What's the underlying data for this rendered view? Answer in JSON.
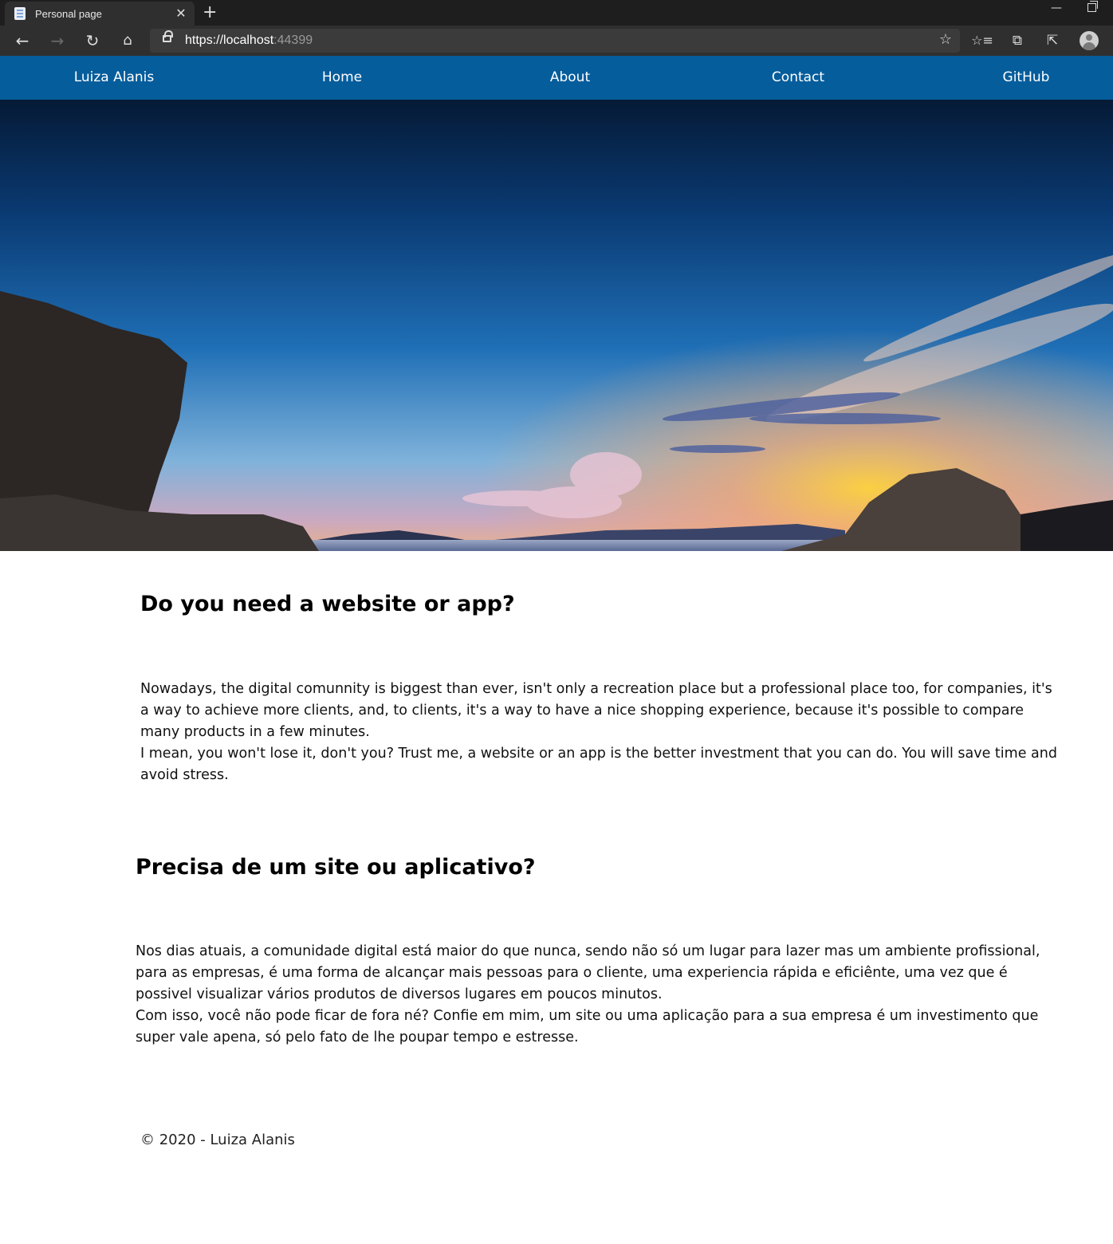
{
  "browser": {
    "tab_title": "Personal page",
    "url_host": "https://localhost",
    "url_port": ":44399"
  },
  "nav": {
    "brand": "Luiza Alanis",
    "items": [
      "Home",
      "About",
      "Contact",
      "GitHub"
    ]
  },
  "sections": [
    {
      "heading": "Do you need a website or app?",
      "paragraph1": "Nowadays, the digital comunnity is biggest than ever, isn't only a recreation place but a professional place too, for companies, it's a way to achieve more clients, and, to clients, it's a way to have a nice shopping experience, because it's possible to compare many products in a few minutes.",
      "paragraph2": "I mean, you won't lose it, don't you? Trust me, a website or an app is the better investment that you can do. You will save time and avoid stress."
    },
    {
      "heading": "Precisa de um site ou aplicativo?",
      "paragraph1": "Nos dias atuais, a comunidade digital está maior do que nunca, sendo não só um lugar para lazer mas um ambiente profissional, para as empresas, é uma forma de alcançar mais pessoas para o cliente, uma experiencia rápida e eficiênte, uma vez que é possivel visualizar vários produtos de diversos lugares em poucos minutos.",
      "paragraph2": "Com isso, você não pode ficar de fora né? Confie em mim, um site ou uma aplicação para a sua empresa é um investimento que super vale apena, só pelo fato de lhe poupar tempo e estresse."
    }
  ],
  "footer": "© 2020 - Luiza Alanis",
  "colors": {
    "nav_bg": "#065d9c",
    "chrome_bg": "#2f2f2f"
  }
}
